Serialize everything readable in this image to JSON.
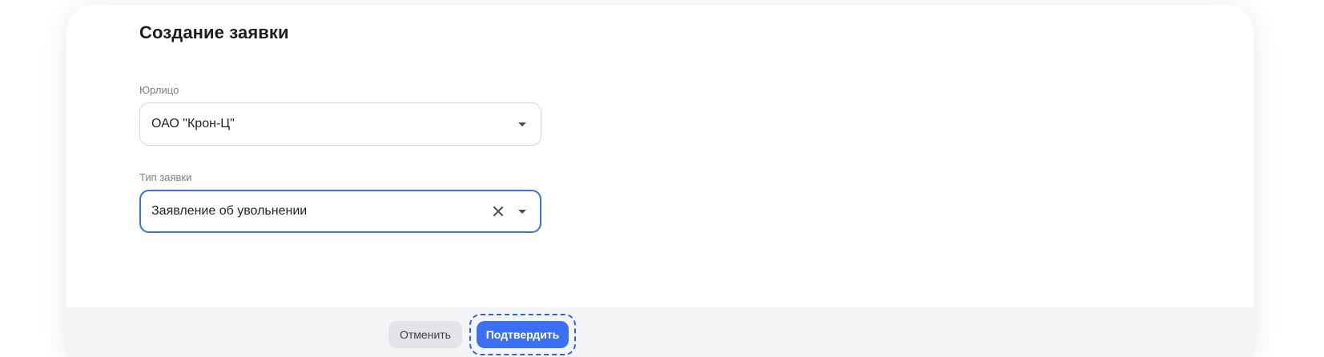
{
  "dialog": {
    "title": "Создание заявки"
  },
  "fields": {
    "entity": {
      "label": "Юрлицо",
      "value": "ОАО \"Крон-Ц\""
    },
    "request_type": {
      "label": "Тип заявки",
      "value": "Заявление об увольнении"
    }
  },
  "footer": {
    "cancel_label": "Отменить",
    "confirm_label": "Подтвердить"
  },
  "colors": {
    "accent": "#3b6ff5",
    "footer_bg": "#f4f5f7",
    "border": "#d4d6db"
  }
}
